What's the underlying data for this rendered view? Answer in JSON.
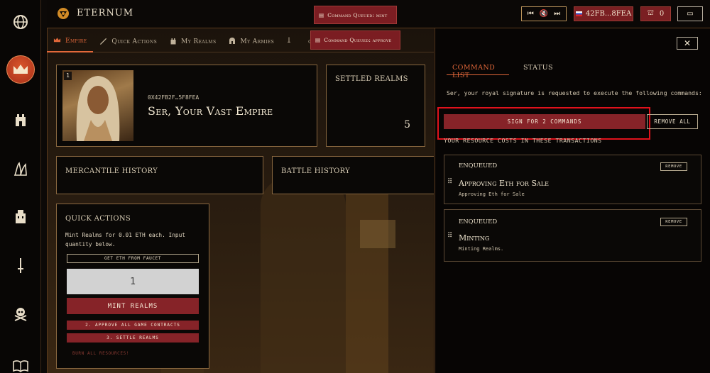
{
  "app": {
    "title": "ETERNUM"
  },
  "rail": {
    "items": [
      "globe-icon",
      "crown-icon",
      "castle-icon",
      "mansion-icon",
      "building-icon",
      "sword-icon",
      "skull-icon",
      "book-icon"
    ]
  },
  "topbar": {
    "address": "42FB...8FEA",
    "realm_count": "0"
  },
  "toasts": {
    "mint": "Command Queued: mint",
    "approve": "Command Queued: approve"
  },
  "tabs": [
    {
      "label": "Empire",
      "icon": "crown-icon"
    },
    {
      "label": "Quick Actions",
      "icon": "quill-icon"
    },
    {
      "label": "My Realms",
      "icon": "castle-icon"
    },
    {
      "label": "My Armies",
      "icon": "helmet-icon"
    },
    {
      "label": "",
      "icon": "sword-icon"
    },
    {
      "label": "ot",
      "icon": ""
    },
    {
      "label": "",
      "icon": "quill-icon"
    }
  ],
  "empire": {
    "badge": "1",
    "address": "0X42FB2F…5F8FEA",
    "heading": "Ser, Your Vast Empire"
  },
  "settled": {
    "title": "SETTLED REALMS",
    "count": "5"
  },
  "history": {
    "mercantile": "MERCANTILE HISTORY",
    "battle": "BATTLE HISTORY"
  },
  "quick": {
    "title": "QUICK ACTIONS",
    "desc": "Mint Realms for 0.01 ETH each. Input quantity below.",
    "faucet": "GET ETH FROM FAUCET",
    "qty": "1",
    "mint": "MINT REALMS",
    "approve": "2. APPROVE ALL GAME CONTRACTS",
    "settle": "3. SETTLE REALMS",
    "burn": "BURN ALL RESOURCES!"
  },
  "right": {
    "tabs": [
      "COMMAND LIST",
      "STATUS"
    ],
    "signature_text": "Ser, your royal signature is requested to execute the following commands:",
    "sign_button": "SIGN FOR 2 COMMANDS",
    "remove_all": "REMOVE ALL",
    "costs_heading": "YOUR RESOURCE COSTS IN THESE TRANSACTIONS",
    "commands": [
      {
        "status": "ENQUEUED",
        "title": "Approving Eth for Sale",
        "sub": "Approving Eth for Sale",
        "remove": "REMOVE"
      },
      {
        "status": "ENQUEUED",
        "title": "Minting",
        "sub": "Minting Realms.",
        "remove": "REMOVE"
      }
    ]
  },
  "colors": {
    "accent": "#e2683a",
    "red": "#862328",
    "highlight": "#e0121c",
    "gold": "#c8a46a"
  }
}
